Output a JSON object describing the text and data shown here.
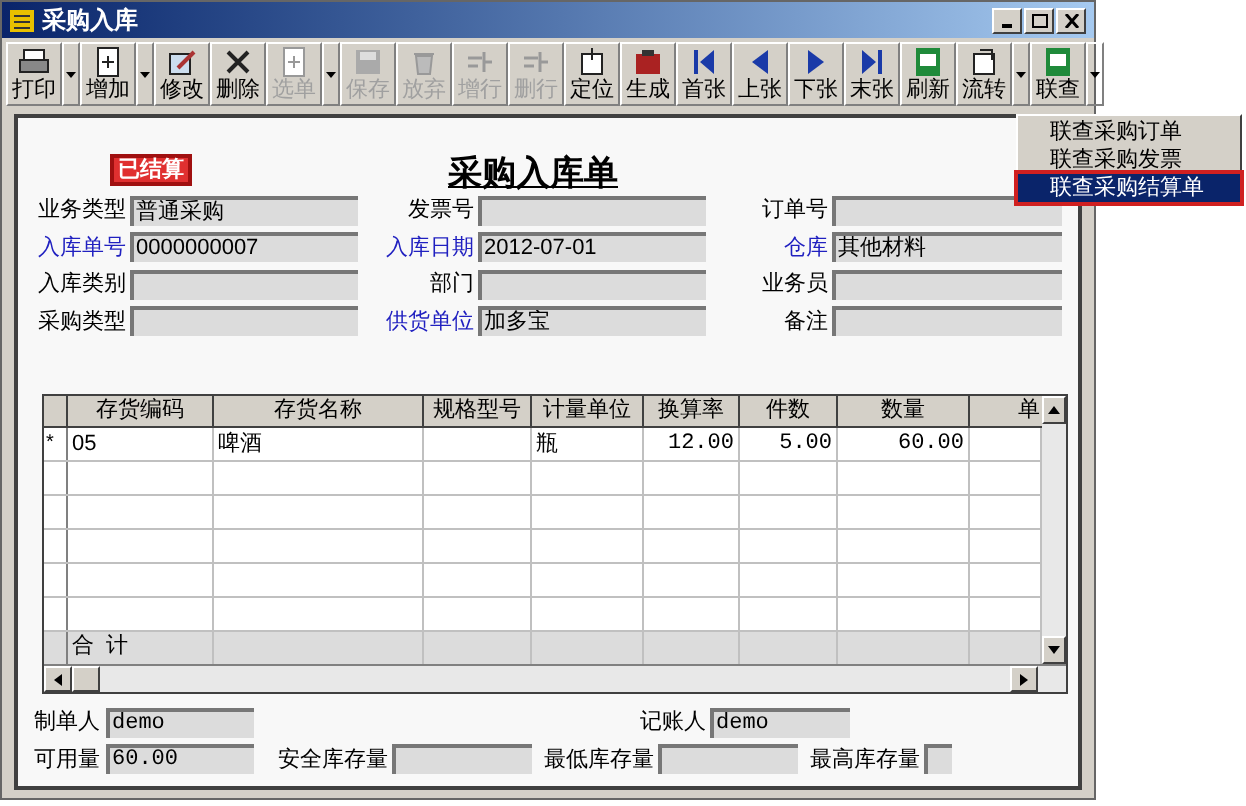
{
  "window": {
    "title": "采购入库"
  },
  "toolbar": [
    {
      "label": "打印",
      "disabled": false,
      "dropdown": true
    },
    {
      "label": "增加",
      "disabled": false,
      "dropdown": true
    },
    {
      "label": "修改",
      "disabled": false,
      "dropdown": false
    },
    {
      "label": "删除",
      "disabled": false,
      "dropdown": false
    },
    {
      "label": "选单",
      "disabled": true,
      "dropdown": true
    },
    {
      "label": "保存",
      "disabled": true,
      "dropdown": false
    },
    {
      "label": "放弃",
      "disabled": true,
      "dropdown": false
    },
    {
      "label": "增行",
      "disabled": true,
      "dropdown": false
    },
    {
      "label": "删行",
      "disabled": true,
      "dropdown": false
    },
    {
      "label": "定位",
      "disabled": false,
      "dropdown": false
    },
    {
      "label": "生成",
      "disabled": false,
      "dropdown": false
    },
    {
      "label": "首张",
      "disabled": false,
      "dropdown": false
    },
    {
      "label": "上张",
      "disabled": false,
      "dropdown": false
    },
    {
      "label": "下张",
      "disabled": false,
      "dropdown": false
    },
    {
      "label": "末张",
      "disabled": false,
      "dropdown": false
    },
    {
      "label": "刷新",
      "disabled": false,
      "dropdown": false
    },
    {
      "label": "流转",
      "disabled": false,
      "dropdown": true
    },
    {
      "label": "联查",
      "disabled": false,
      "dropdown": true
    }
  ],
  "menu": [
    {
      "label": "联查采购订单",
      "selected": false
    },
    {
      "label": "联查采购发票",
      "selected": false
    },
    {
      "label": "联查采购结算单",
      "selected": true
    }
  ],
  "stamp": "已结算",
  "form_title": "采购入库单",
  "header_fields": [
    [
      {
        "label": "业务类型",
        "value": "普通采购",
        "linked": false
      },
      {
        "label": "发票号",
        "linked": false
      },
      {
        "label": "订单号",
        "linked": false
      }
    ],
    [
      {
        "label": "入库单号",
        "value": "0000000007",
        "linked": true
      },
      {
        "label": "入库日期",
        "value": "2012-07-01",
        "linked": true
      },
      {
        "label": "仓库",
        "value": "其他材料",
        "linked": true
      }
    ],
    [
      {
        "label": "入库类别",
        "linked": false
      },
      {
        "label": "部门",
        "linked": false
      },
      {
        "label": "业务员",
        "linked": false
      }
    ],
    [
      {
        "label": "采购类型",
        "linked": false
      },
      {
        "label": "供货单位",
        "value": "加多宝",
        "linked": true
      },
      {
        "label": "备注",
        "linked": false
      }
    ]
  ],
  "table": {
    "columns": [
      "存货编码",
      "存货名称",
      "规格型号",
      "计量单位",
      "换算率",
      "件数",
      "数量",
      "单"
    ],
    "rows": [
      {
        "marker": "*",
        "cells": [
          "05",
          "啤酒",
          "",
          "瓶",
          "12.00",
          "5.00",
          "60.00",
          ""
        ]
      }
    ],
    "total_label": "合  计"
  },
  "footer_fields": [
    [
      {
        "label": "制单人",
        "value": "demo"
      },
      {
        "label": "记账人",
        "value": "demo"
      }
    ],
    [
      {
        "label": "可用量",
        "value": "60.00"
      },
      {
        "label": "安全库存量"
      },
      {
        "label": "最低库存量"
      },
      {
        "label": "最高库存量"
      }
    ]
  ]
}
